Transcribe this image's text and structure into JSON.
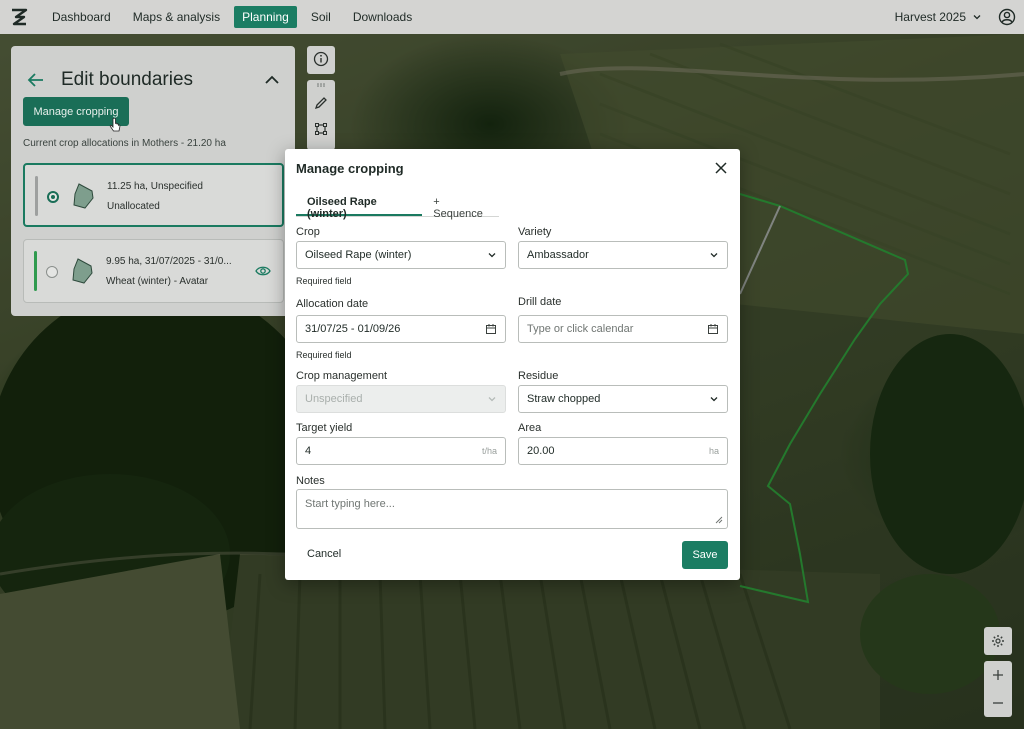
{
  "nav": {
    "items": [
      {
        "label": "Dashboard"
      },
      {
        "label": "Maps & analysis"
      },
      {
        "label": "Planning"
      },
      {
        "label": "Soil"
      },
      {
        "label": "Downloads"
      }
    ],
    "active": "Planning",
    "season": "Harvest 2025"
  },
  "panel": {
    "title": "Edit boundaries",
    "manage_button": "Manage cropping",
    "caption": "Current crop allocations in Mothers - 21.20 ha",
    "allocations": [
      {
        "line1": "11.25 ha,  Unspecified",
        "line2": "Unallocated",
        "selected": true,
        "bar_color": "#9ea09f"
      },
      {
        "line1": "9.95 ha,  31/07/2025 - 31/0...",
        "line2": "Wheat (winter) - Avatar",
        "selected": false,
        "bar_color": "#2f9a4e"
      }
    ]
  },
  "modal": {
    "title": "Manage cropping",
    "tabs": [
      {
        "label": "Oilseed Rape (winter)"
      },
      {
        "label": "+ Sequence"
      }
    ],
    "crop": {
      "label": "Crop",
      "value": "Oilseed Rape (winter)",
      "hint": "Required field"
    },
    "variety": {
      "label": "Variety",
      "value": "Ambassador"
    },
    "allocation_date": {
      "label": "Allocation date",
      "value": "31/07/25 - 01/09/26",
      "hint": "Required field"
    },
    "drill_date": {
      "label": "Drill date",
      "placeholder": "Type or click calendar"
    },
    "crop_management": {
      "label": "Crop management",
      "value": "Unspecified"
    },
    "residue": {
      "label": "Residue",
      "value": "Straw chopped"
    },
    "target_yield": {
      "label": "Target yield",
      "value": "4",
      "unit": "t/ha"
    },
    "area": {
      "label": "Area",
      "value": "20.00",
      "unit": "ha"
    },
    "notes": {
      "label": "Notes",
      "placeholder": "Start typing here..."
    },
    "cancel_label": "Cancel",
    "save_label": "Save"
  },
  "colors": {
    "accent": "#1b7d63",
    "boundary": "#3bc44a"
  }
}
